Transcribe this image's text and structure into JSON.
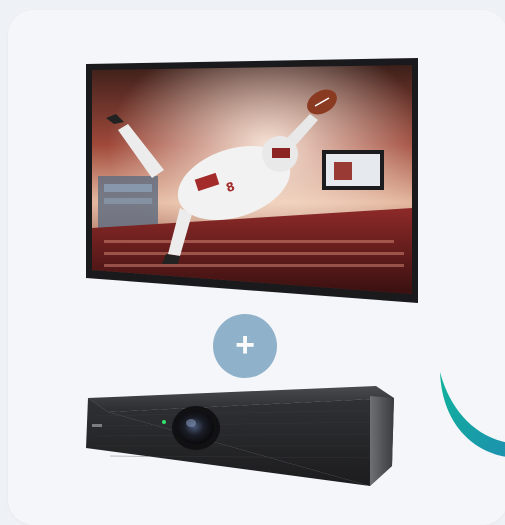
{
  "product_card": {
    "plus_symbol": "+",
    "accent_color": "#8fb1c9",
    "teal_accent": "#19b5a3",
    "items": [
      {
        "icon": "wall-display-tv-icon"
      },
      {
        "icon": "video-bar-camera-icon"
      }
    ]
  }
}
